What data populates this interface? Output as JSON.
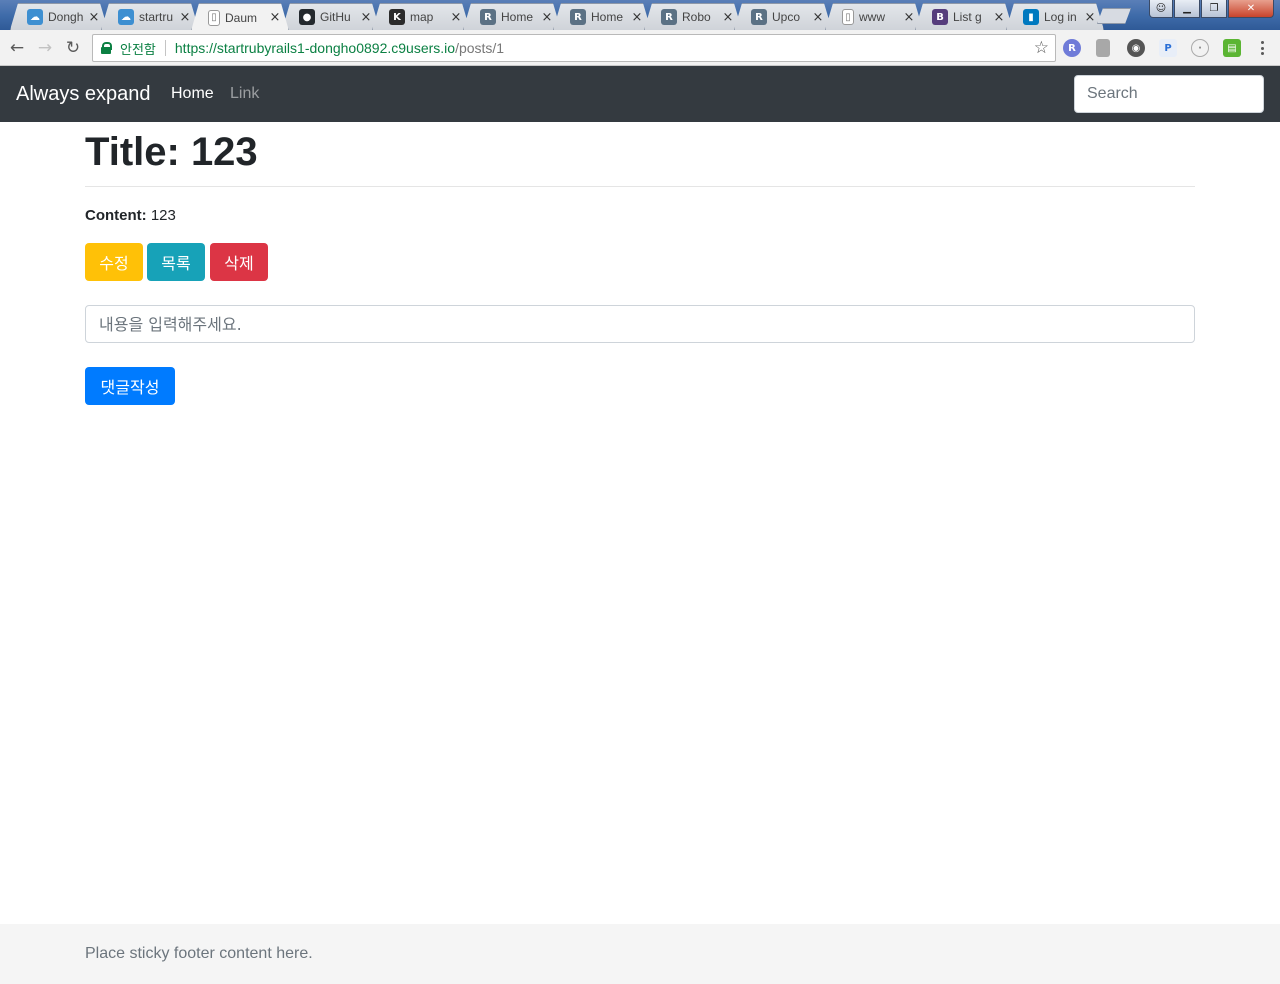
{
  "browser": {
    "tabs": [
      {
        "title": "Dongh",
        "icon": "cloud9-icon",
        "icon_color": "#3d8fd1"
      },
      {
        "title": "startru",
        "icon": "cloud9-icon",
        "icon_color": "#3d8fd1"
      },
      {
        "title": "Daum",
        "icon": "page-icon",
        "icon_color": "#ffffff",
        "active": true
      },
      {
        "title": "GitHu",
        "icon": "github-icon",
        "icon_color": "#24292e"
      },
      {
        "title": "map",
        "icon": "k-icon",
        "icon_color": "#2b2b2b"
      },
      {
        "title": "Home",
        "icon": "r-icon",
        "icon_color": "#5b7184"
      },
      {
        "title": "Home",
        "icon": "r-icon",
        "icon_color": "#5b7184"
      },
      {
        "title": "Robo",
        "icon": "r-icon",
        "icon_color": "#5b7184"
      },
      {
        "title": "Upco",
        "icon": "r-icon",
        "icon_color": "#5b7184"
      },
      {
        "title": "www",
        "icon": "page-icon",
        "icon_color": "#ffffff"
      },
      {
        "title": "List g",
        "icon": "bootstrap-icon",
        "icon_color": "#563d7c"
      },
      {
        "title": "Log in",
        "icon": "trello-icon",
        "icon_color": "#0079bf"
      }
    ],
    "close_glyph": "×",
    "secure_label": "안전함",
    "url_host": "https://startrubyrails1-dongho0892.c9users.io",
    "url_path": "/posts/1"
  },
  "navbar": {
    "brand": "Always expand",
    "links": [
      {
        "label": "Home",
        "active": true
      },
      {
        "label": "Link",
        "active": false
      }
    ],
    "search_placeholder": "Search"
  },
  "post": {
    "title": "Title: 123",
    "content_label": "Content:",
    "content_value": "123"
  },
  "actions": {
    "edit_label": "수정",
    "list_label": "목록",
    "delete_label": "삭제"
  },
  "comment": {
    "placeholder": "내용을 입력해주세요.",
    "submit_label": "댓글작성"
  },
  "footer": {
    "text": "Place sticky footer content here."
  },
  "colors": {
    "navbar_bg": "#343a40",
    "warning": "#ffc107",
    "info": "#17a2b8",
    "danger": "#dc3545",
    "primary": "#007bff",
    "footer_bg": "#f5f5f5"
  }
}
